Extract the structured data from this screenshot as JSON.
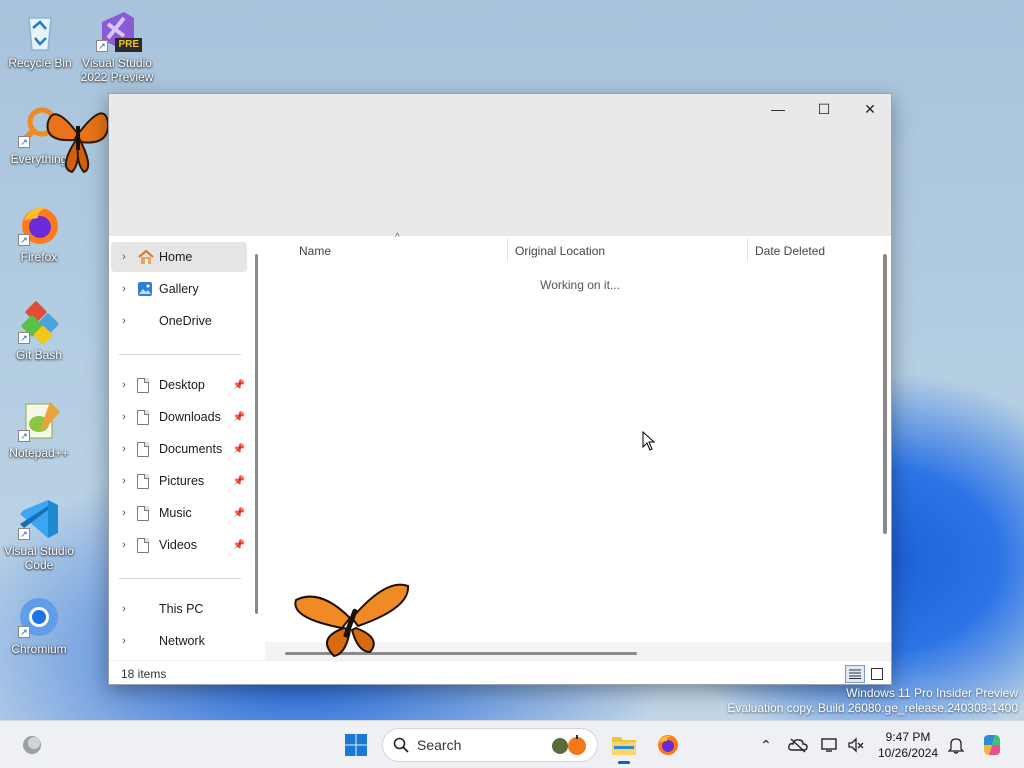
{
  "desktop": {
    "icons": [
      {
        "label": "Recycle Bin"
      },
      {
        "label": "Visual Studio 2022 Preview",
        "badge": "PRE"
      },
      {
        "label": "Everything"
      },
      {
        "label": "Firefox"
      },
      {
        "label": "Git Bash"
      },
      {
        "label": "Notepad++"
      },
      {
        "label": "Visual Studio Code"
      },
      {
        "label": "Chromium"
      }
    ]
  },
  "window": {
    "controls": {
      "minimize": "—",
      "maximize": "☐",
      "close": "✕"
    },
    "nav": {
      "items": [
        {
          "label": "Home",
          "icon": "home-icon",
          "active": true
        },
        {
          "label": "Gallery",
          "icon": "gallery-icon"
        },
        {
          "label": "OneDrive",
          "icon": ""
        },
        {
          "label": "Desktop",
          "icon": "document-icon",
          "pinned": true
        },
        {
          "label": "Downloads",
          "icon": "document-icon",
          "pinned": true
        },
        {
          "label": "Documents",
          "icon": "document-icon",
          "pinned": true
        },
        {
          "label": "Pictures",
          "icon": "document-icon",
          "pinned": true
        },
        {
          "label": "Music",
          "icon": "document-icon",
          "pinned": true
        },
        {
          "label": "Videos",
          "icon": "document-icon",
          "pinned": true
        },
        {
          "label": "This PC",
          "icon": ""
        },
        {
          "label": "Network",
          "icon": ""
        }
      ]
    },
    "columns": [
      "Name",
      "Original Location",
      "Date Deleted"
    ],
    "status_message": "Working on it...",
    "status_bar": {
      "item_count": "18 items"
    }
  },
  "watermark": {
    "line1": "Windows 11 Pro Insider Preview",
    "line2": "Evaluation copy. Build 26080.ge_release.240308-1400"
  },
  "taskbar": {
    "search_label": "Search",
    "time": "9:47 PM",
    "date": "10/26/2024"
  },
  "colors": {
    "accent": "#0067c0",
    "window_title_bg": "#e9e9e9",
    "nav_active_bg": "#e5e5e5",
    "taskbar_bg": "#eef0f3"
  }
}
